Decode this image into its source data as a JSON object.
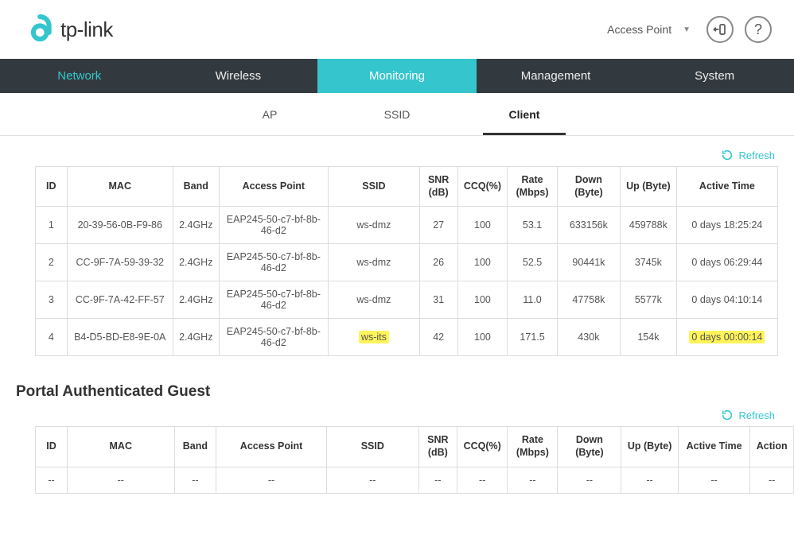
{
  "header": {
    "brand": "tp-link",
    "ap_selector": "Access Point"
  },
  "nav": {
    "main": [
      "Network",
      "Wireless",
      "Monitoring",
      "Management",
      "System"
    ],
    "sub": [
      "AP",
      "SSID",
      "Client"
    ]
  },
  "refresh_label": "Refresh",
  "clients": {
    "headers": {
      "id": "ID",
      "mac": "MAC",
      "band": "Band",
      "ap": "Access Point",
      "ssid": "SSID",
      "snr": "SNR (dB)",
      "ccq": "CCQ(%)",
      "rate": "Rate (Mbps)",
      "down": "Down (Byte)",
      "up": "Up (Byte)",
      "active": "Active Time"
    },
    "rows": [
      {
        "id": "1",
        "mac": "20-39-56-0B-F9-86",
        "band": "2.4GHz",
        "ap": "EAP245-50-c7-bf-8b-46-d2",
        "ssid": "ws-dmz",
        "snr": "27",
        "ccq": "100",
        "rate": "53.1",
        "down": "633156k",
        "up": "459788k",
        "active": "0 days 18:25:24",
        "hl_ssid": false,
        "hl_active": false
      },
      {
        "id": "2",
        "mac": "CC-9F-7A-59-39-32",
        "band": "2.4GHz",
        "ap": "EAP245-50-c7-bf-8b-46-d2",
        "ssid": "ws-dmz",
        "snr": "26",
        "ccq": "100",
        "rate": "52.5",
        "down": "90441k",
        "up": "3745k",
        "active": "0 days 06:29:44",
        "hl_ssid": false,
        "hl_active": false
      },
      {
        "id": "3",
        "mac": "CC-9F-7A-42-FF-57",
        "band": "2.4GHz",
        "ap": "EAP245-50-c7-bf-8b-46-d2",
        "ssid": "ws-dmz",
        "snr": "31",
        "ccq": "100",
        "rate": "11.0",
        "down": "47758k",
        "up": "5577k",
        "active": "0 days 04:10:14",
        "hl_ssid": false,
        "hl_active": false
      },
      {
        "id": "4",
        "mac": "B4-D5-BD-E8-9E-0A",
        "band": "2.4GHz",
        "ap": "EAP245-50-c7-bf-8b-46-d2",
        "ssid": "ws-its",
        "snr": "42",
        "ccq": "100",
        "rate": "171.5",
        "down": "430k",
        "up": "154k",
        "active": "0 days 00:00:14",
        "hl_ssid": true,
        "hl_active": true
      }
    ]
  },
  "portal": {
    "title": "Portal Authenticated Guest",
    "headers": {
      "id": "ID",
      "mac": "MAC",
      "band": "Band",
      "ap": "Access Point",
      "ssid": "SSID",
      "snr": "SNR (dB)",
      "ccq": "CCQ(%)",
      "rate": "Rate (Mbps)",
      "down": "Down (Byte)",
      "up": "Up (Byte)",
      "active": "Active Time",
      "action": "Action"
    },
    "empty": "--"
  }
}
